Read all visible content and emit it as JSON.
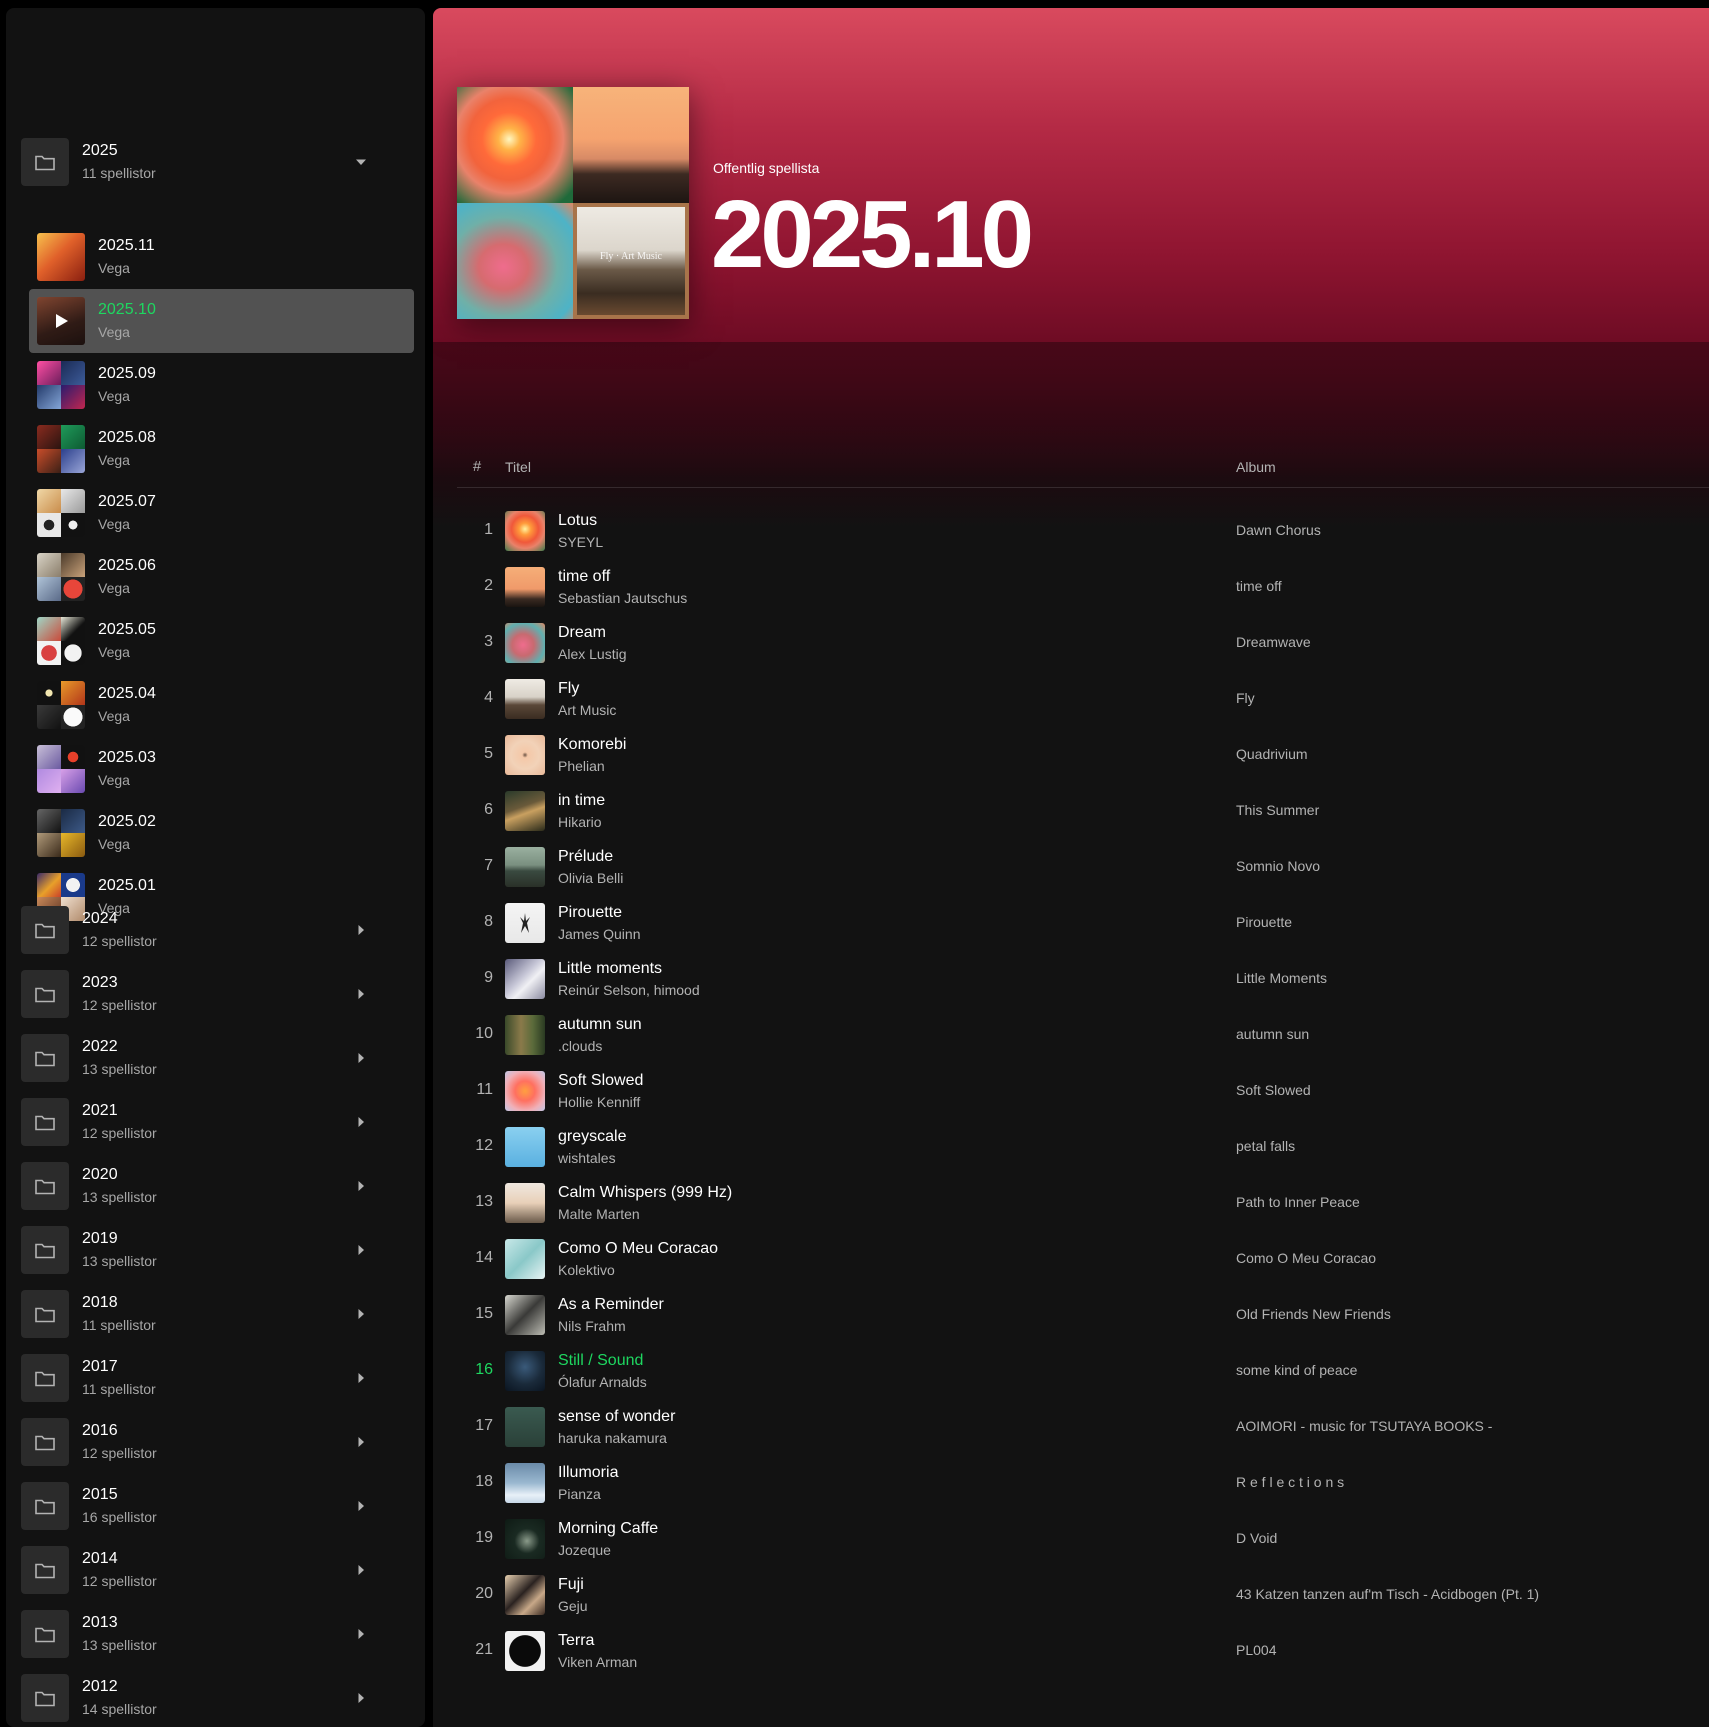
{
  "sidebar": {
    "folders_top": [
      {
        "title": "2025",
        "subtitle": "11 spellistor",
        "expanded": true
      }
    ],
    "playlists": [
      {
        "title": "2025.11",
        "owner": "Vega",
        "active": false
      },
      {
        "title": "2025.10",
        "owner": "Vega",
        "active": true
      },
      {
        "title": "2025.09",
        "owner": "Vega",
        "active": false
      },
      {
        "title": "2025.08",
        "owner": "Vega",
        "active": false
      },
      {
        "title": "2025.07",
        "owner": "Vega",
        "active": false
      },
      {
        "title": "2025.06",
        "owner": "Vega",
        "active": false
      },
      {
        "title": "2025.05",
        "owner": "Vega",
        "active": false
      },
      {
        "title": "2025.04",
        "owner": "Vega",
        "active": false
      },
      {
        "title": "2025.03",
        "owner": "Vega",
        "active": false
      },
      {
        "title": "2025.02",
        "owner": "Vega",
        "active": false
      },
      {
        "title": "2025.01",
        "owner": "Vega",
        "active": false
      }
    ],
    "folders": [
      {
        "title": "2024",
        "subtitle": "12 spellistor"
      },
      {
        "title": "2023",
        "subtitle": "12 spellistor"
      },
      {
        "title": "2022",
        "subtitle": "13 spellistor"
      },
      {
        "title": "2021",
        "subtitle": "12 spellistor"
      },
      {
        "title": "2020",
        "subtitle": "13 spellistor"
      },
      {
        "title": "2019",
        "subtitle": "13 spellistor"
      },
      {
        "title": "2018",
        "subtitle": "11 spellistor"
      },
      {
        "title": "2017",
        "subtitle": "11 spellistor"
      },
      {
        "title": "2016",
        "subtitle": "12 spellistor"
      },
      {
        "title": "2015",
        "subtitle": "16 spellistor"
      },
      {
        "title": "2014",
        "subtitle": "12 spellistor"
      },
      {
        "title": "2013",
        "subtitle": "13 spellistor"
      },
      {
        "title": "2012",
        "subtitle": "14 spellistor"
      }
    ]
  },
  "header": {
    "type_label": "Offentlig spellista",
    "title": "2025.10",
    "cover_text": "Fly · Art Music"
  },
  "table": {
    "col_num": "#",
    "col_title": "Titel",
    "col_album": "Album"
  },
  "tracks": [
    {
      "num": "1",
      "title": "Lotus",
      "artist": "SYEYL",
      "album": "Dawn Chorus",
      "playing": false
    },
    {
      "num": "2",
      "title": "time off",
      "artist": "Sebastian Jautschus",
      "album": "time off",
      "playing": false
    },
    {
      "num": "3",
      "title": "Dream",
      "artist": "Alex Lustig",
      "album": "Dreamwave",
      "playing": false
    },
    {
      "num": "4",
      "title": "Fly",
      "artist": "Art Music",
      "album": "Fly",
      "playing": false
    },
    {
      "num": "5",
      "title": "Komorebi",
      "artist": "Phelian",
      "album": "Quadrivium",
      "playing": false
    },
    {
      "num": "6",
      "title": "in time",
      "artist": "Hikario",
      "album": "This Summer",
      "playing": false
    },
    {
      "num": "7",
      "title": "Prélude",
      "artist": "Olivia Belli",
      "album": "Somnio Novo",
      "playing": false
    },
    {
      "num": "8",
      "title": "Pirouette",
      "artist": "James Quinn",
      "album": "Pirouette",
      "playing": false
    },
    {
      "num": "9",
      "title": "Little moments",
      "artist": "Reinúr Selson, himood",
      "album": "Little Moments",
      "playing": false
    },
    {
      "num": "10",
      "title": "autumn sun",
      "artist": ".clouds",
      "album": "autumn sun",
      "playing": false
    },
    {
      "num": "11",
      "title": "Soft Slowed",
      "artist": "Hollie Kenniff",
      "album": "Soft Slowed",
      "playing": false
    },
    {
      "num": "12",
      "title": "greyscale",
      "artist": "wishtales",
      "album": "petal falls",
      "playing": false
    },
    {
      "num": "13",
      "title": "Calm Whispers (999 Hz)",
      "artist": "Malte Marten",
      "album": "Path to Inner Peace",
      "playing": false
    },
    {
      "num": "14",
      "title": "Como O Meu Coracao",
      "artist": "Kolektivo",
      "album": "Como O Meu Coracao",
      "playing": false
    },
    {
      "num": "15",
      "title": "As a Reminder",
      "artist": "Nils Frahm",
      "album": "Old Friends New Friends",
      "playing": false
    },
    {
      "num": "16",
      "title": "Still / Sound",
      "artist": "Ólafur Arnalds",
      "album": "some kind of peace",
      "playing": true
    },
    {
      "num": "17",
      "title": "sense of wonder",
      "artist": "haruka nakamura",
      "album": "AOIMORI - music for TSUTAYA BOOKS -",
      "playing": false
    },
    {
      "num": "18",
      "title": "Illumoria",
      "artist": "Pianza",
      "album": "R e f l e c t i o n s",
      "playing": false
    },
    {
      "num": "19",
      "title": "Morning Caffe",
      "artist": "Jozeque",
      "album": "D Void",
      "playing": false
    },
    {
      "num": "20",
      "title": "Fuji",
      "artist": "Geju",
      "album": "43 Katzen tanzen auf'm Tisch - Acidbogen (Pt. 1)",
      "playing": false
    },
    {
      "num": "21",
      "title": "Terra",
      "artist": "Viken Arman",
      "album": "PL004",
      "playing": false
    }
  ],
  "colors": {
    "accent_green": "#1ed760",
    "hero_red": "#d94a5e",
    "hero_dark": "#6e0c24",
    "surface": "#121212",
    "active_row": "#525252"
  }
}
